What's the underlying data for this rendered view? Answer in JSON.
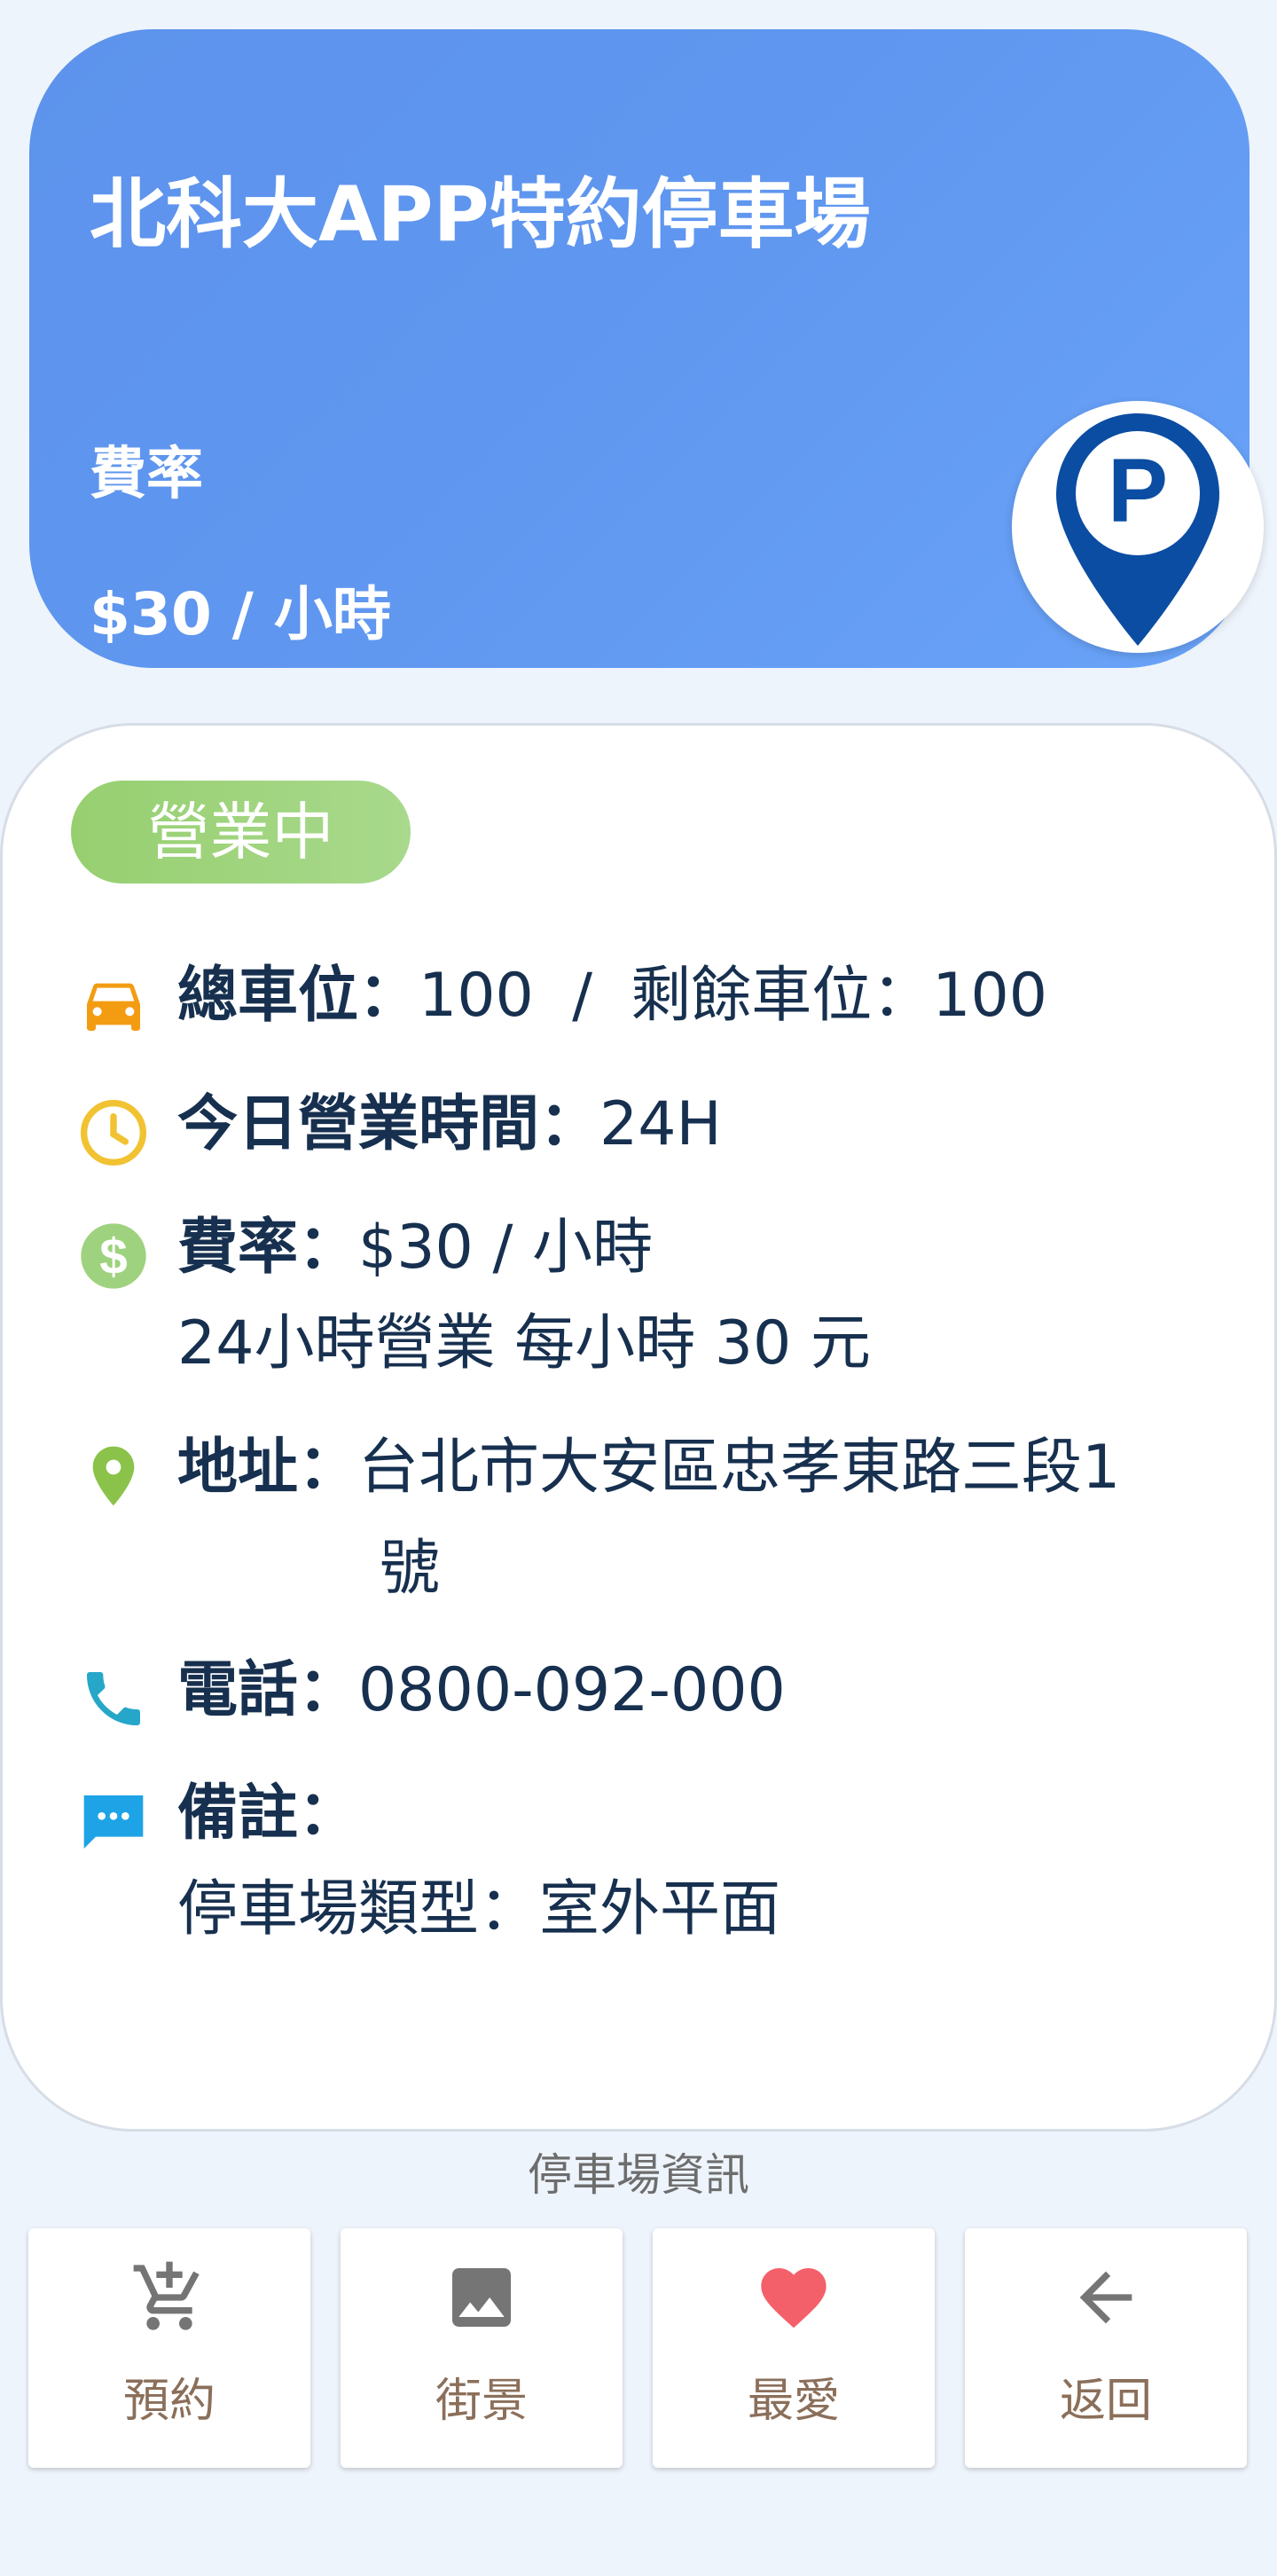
{
  "header": {
    "title": "北科大APP特約停車場",
    "rate_label": "費率",
    "rate_value": "$30 / 小時",
    "badge_icon": "parking-pin-icon",
    "gradient": [
      "#5d93ec",
      "#69a3f8"
    ]
  },
  "status": {
    "label": "營業中",
    "color": "#a0d47f"
  },
  "info": {
    "spaces": {
      "label": "總車位",
      "sep": "：",
      "total": "100",
      "divider": "/",
      "remain_label": "剩餘車位",
      "remain": "100",
      "icon": "car-icon",
      "icon_color": "#f39c12"
    },
    "hours": {
      "label": "今日營業時間",
      "sep": "：",
      "value": "24H",
      "icon": "clock-icon",
      "icon_color": "#f1c232"
    },
    "rate": {
      "label": "費率",
      "sep": "：",
      "value": "$30 / 小時",
      "detail": "24小時營業 每小時 30 元",
      "icon": "dollar-icon",
      "icon_color": "#9ed27e"
    },
    "address": {
      "label": "地址",
      "sep": "：",
      "value_line1": "台北市大安區忠孝東路三段1",
      "value_line2": "號",
      "icon": "location-pin-icon",
      "icon_color": "#8bc34a"
    },
    "phone": {
      "label": "電話",
      "sep": "：",
      "value": "0800-092-000",
      "icon": "phone-icon",
      "icon_color": "#26a7c9"
    },
    "notes": {
      "label": "備註",
      "sep": "：",
      "value": "停車場類型：室外平面",
      "icon": "chat-icon",
      "icon_color": "#1ea3e6"
    }
  },
  "caption": "停車場資訊",
  "actions": [
    {
      "label": "預約",
      "icon": "add-cart-icon"
    },
    {
      "label": "街景",
      "icon": "image-icon"
    },
    {
      "label": "最愛",
      "icon": "heart-icon",
      "color": "#f4606a"
    },
    {
      "label": "返回",
      "icon": "arrow-back-icon"
    }
  ]
}
